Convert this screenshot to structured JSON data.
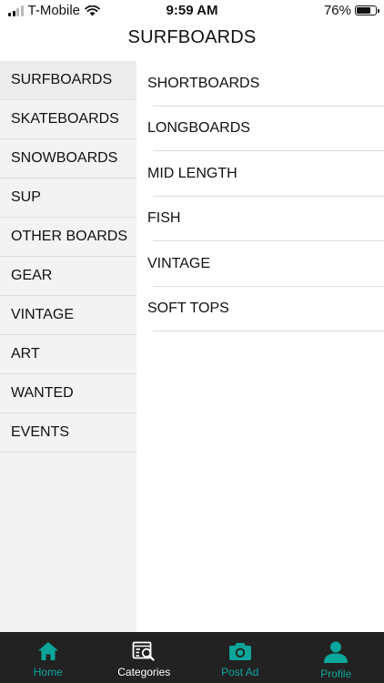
{
  "status_bar": {
    "carrier": "T-Mobile",
    "time": "9:59 AM",
    "battery": "76%",
    "battery_level": 0.76
  },
  "header": {
    "title": "SURFBOARDS"
  },
  "sidebar": {
    "items": [
      {
        "label": "SURFBOARDS"
      },
      {
        "label": "SKATEBOARDS"
      },
      {
        "label": "SNOWBOARDS"
      },
      {
        "label": "SUP"
      },
      {
        "label": "OTHER BOARDS"
      },
      {
        "label": "GEAR"
      },
      {
        "label": "VINTAGE"
      },
      {
        "label": "ART"
      },
      {
        "label": "WANTED"
      },
      {
        "label": "EVENTS"
      }
    ],
    "selected": "SURFBOARDS"
  },
  "subcategories": {
    "items": [
      {
        "label": "SHORTBOARDS"
      },
      {
        "label": "LONGBOARDS"
      },
      {
        "label": "MID LENGTH"
      },
      {
        "label": "FISH"
      },
      {
        "label": "VINTAGE"
      },
      {
        "label": "SOFT TOPS"
      }
    ]
  },
  "tab_bar": {
    "tabs": [
      {
        "label": "Home",
        "icon": "home-icon"
      },
      {
        "label": "Categories",
        "icon": "categories-icon"
      },
      {
        "label": "Post Ad",
        "icon": "camera-icon"
      },
      {
        "label": "Profile",
        "icon": "profile-icon"
      }
    ],
    "active": "Categories"
  },
  "colors": {
    "accent": "#0aa69a",
    "tab_bar_bg": "#222222",
    "sidebar_bg": "#f3f3f3",
    "active_tab_label": "#ffffff"
  }
}
